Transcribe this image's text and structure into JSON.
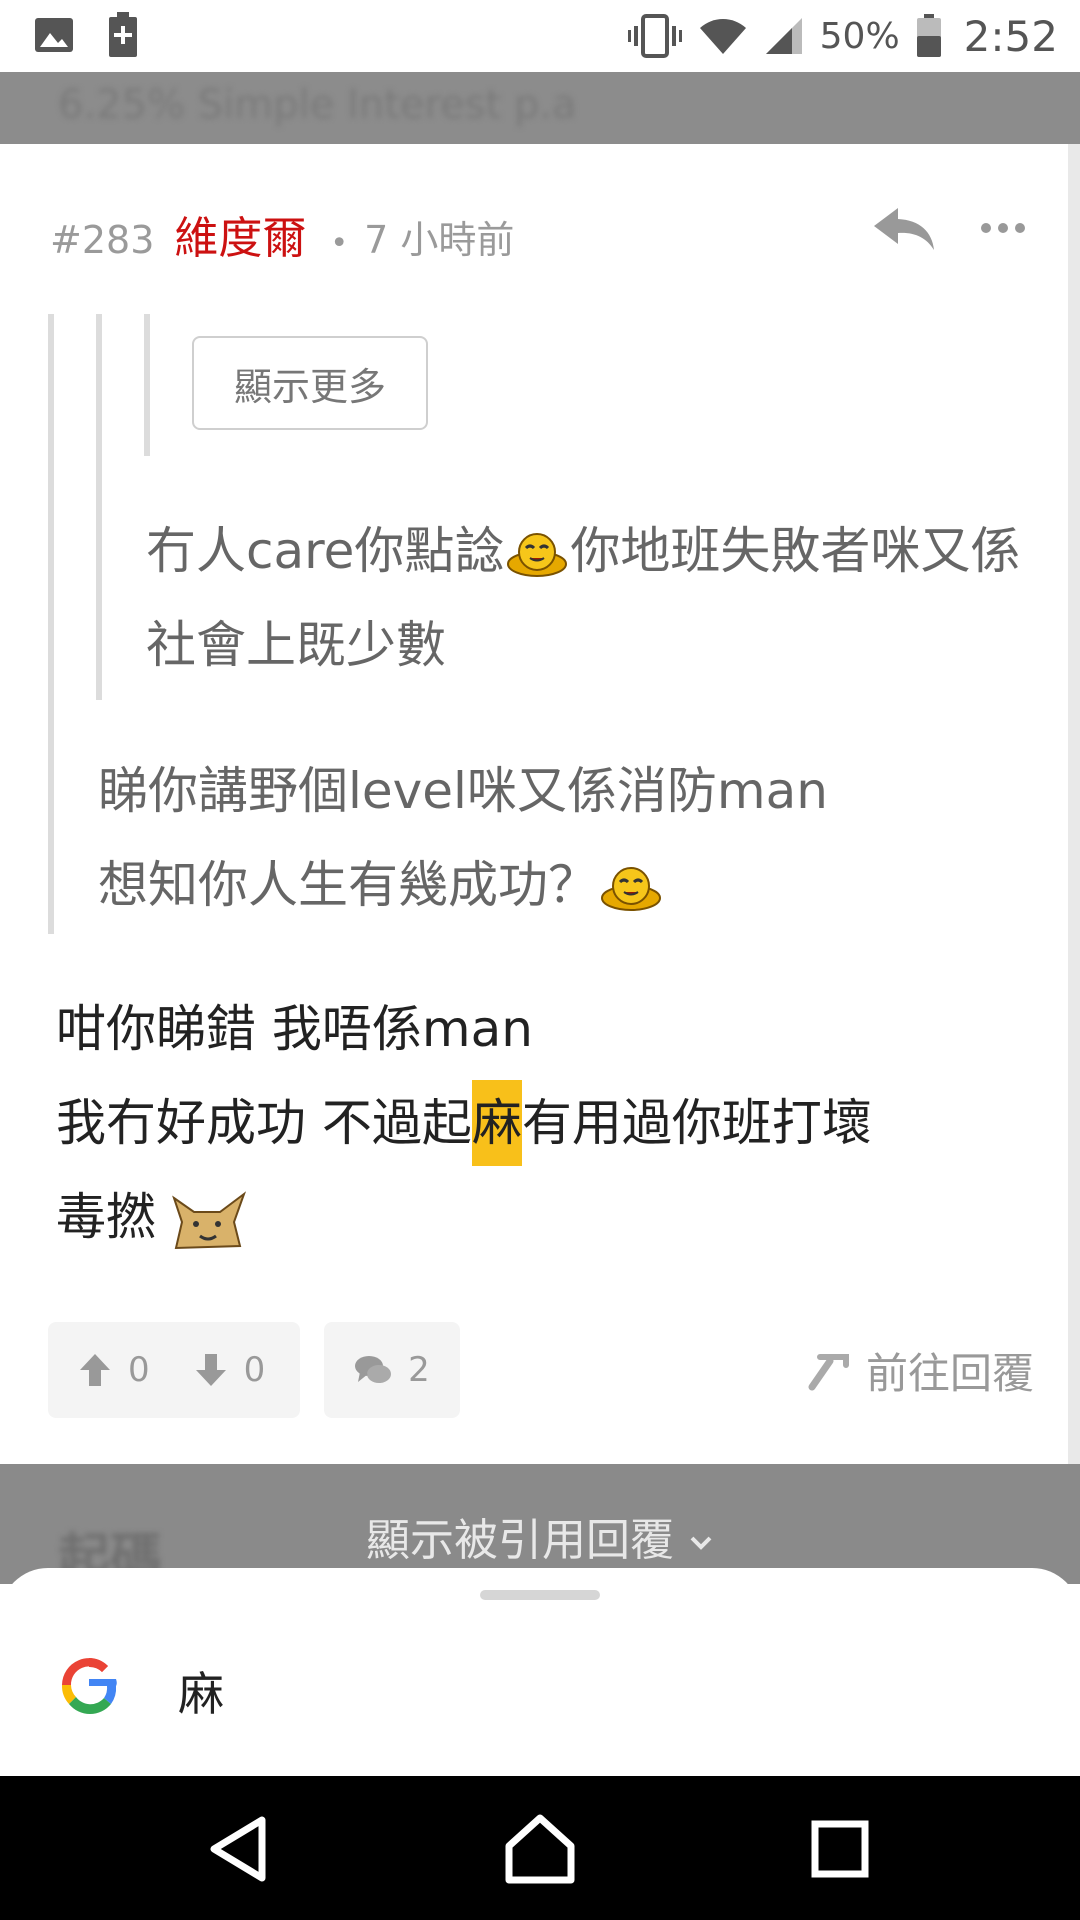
{
  "status_bar": {
    "battery_percent": "50%",
    "time": "2:52",
    "icons": [
      "image-icon",
      "battery-saver-icon",
      "vibrate-icon",
      "wifi-icon",
      "signal-icon",
      "battery-icon"
    ]
  },
  "top_blurred_text": "6.25% Simple Interest p.a",
  "post": {
    "number": "#283",
    "username": "維度爾",
    "separator": "•",
    "time_ago": "7 小時前",
    "show_more_label": "顯示更多",
    "quote_inner": "冇人care你點諗",
    "quote_inner_after": "你地班失敗者咪又係社會上既少數",
    "quote_outer_line1": "睇你講野個level咪又係消防man",
    "quote_outer_line2": "想知你人生有幾成功？",
    "body_line1": "咁你睇錯 我唔係man",
    "body_line2_before": "我冇好成功 不過起",
    "body_highlight": "麻",
    "body_line2_after": "有用過你班打壞",
    "body_line3": "毒撚",
    "upvotes": "0",
    "downvotes": "0",
    "comments": "2",
    "goto_reply_label": "前往回覆"
  },
  "dim_section": {
    "blurred_text": "起碼",
    "show_quoted_label": "顯示被引用回覆"
  },
  "bottom_sheet": {
    "query": "麻"
  },
  "colors": {
    "username": "#cc1111",
    "highlight": "#f8c01a"
  }
}
